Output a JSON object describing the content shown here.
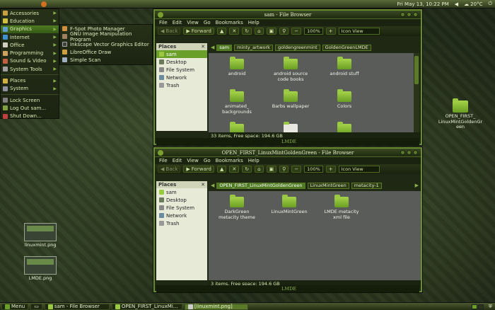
{
  "topbar": {
    "clock": "Fri May 13, 10:22 PM",
    "temp": "20°C"
  },
  "appmenu": {
    "items": [
      {
        "label": "Accessories",
        "color": "#c8a040"
      },
      {
        "label": "Education",
        "color": "#d0c040"
      },
      {
        "label": "Graphics",
        "color": "#60a0d0"
      },
      {
        "label": "Internet",
        "color": "#4090d0"
      },
      {
        "label": "Office",
        "color": "#d0d0c0"
      },
      {
        "label": "Programming",
        "color": "#d0a060"
      },
      {
        "label": "Sound & Video",
        "color": "#c06040"
      },
      {
        "label": "System Tools",
        "color": "#a0a0a0"
      },
      {
        "label": "Places",
        "color": "#d0b040"
      },
      {
        "label": "System",
        "color": "#9090a0"
      },
      {
        "label": "Lock Screen",
        "color": "#808080"
      },
      {
        "label": "Log Out sam...",
        "color": "#80a040"
      },
      {
        "label": "Shut Down...",
        "color": "#c04040"
      }
    ]
  },
  "submenu": {
    "items": [
      {
        "label": "F-Spot Photo Manager",
        "color": "#d09040"
      },
      {
        "label": "GNU Image Manipulation Program",
        "color": "#a08060"
      },
      {
        "label": "Inkscape Vector Graphics Editor",
        "color": "#404040"
      },
      {
        "label": "LibreOffice Draw",
        "color": "#d0a040"
      },
      {
        "label": "Simple Scan",
        "color": "#a0b0c0"
      }
    ]
  },
  "win1": {
    "title": "sam - File Browser",
    "menu": [
      "File",
      "Edit",
      "View",
      "Go",
      "Bookmarks",
      "Help"
    ],
    "back": "Back",
    "forward": "Forward",
    "zoom": "100%",
    "view": "Icon View",
    "places_header": "Places",
    "places": [
      "sam",
      "Desktop",
      "File System",
      "Network",
      "Trash"
    ],
    "crumbs": [
      "sam",
      "minty_artwork",
      "goldengreenmint",
      "GoldenGreenLMDE"
    ],
    "files": [
      "android",
      "android source code books",
      "android stuff",
      "animated_ backgrounds",
      "Barbs wallpaper",
      "Colors",
      "",
      "",
      ""
    ],
    "status": "33 items, Free space: 194.6 GB",
    "footer": "LMDE"
  },
  "win2": {
    "title": "OPEN_FIRST_LinuxMintGoldenGreen - File Browser",
    "menu": [
      "File",
      "Edit",
      "View",
      "Go",
      "Bookmarks",
      "Help"
    ],
    "back": "Back",
    "forward": "Forward",
    "zoom": "100%",
    "view": "Icon View",
    "places_header": "Places",
    "places": [
      "sam",
      "Desktop",
      "File System",
      "Network",
      "Trash"
    ],
    "crumbs": [
      "OPEN_FIRST_LinuxMintGoldenGreen",
      "LinuxMintGreen",
      "metacity-1"
    ],
    "files": [
      "DarkGreen metacity theme",
      "LinuxMintGreen",
      "LMDE metacity xml file"
    ],
    "status": "3 items, Free space: 194.6 GB",
    "footer": "LMDE"
  },
  "desktop": {
    "folder": "OPEN_FIRST_ LinuxMintGoldenGr een",
    "img1": "linuxmint.png",
    "img2": "LMDE.png"
  },
  "taskbar": {
    "menu": "Menu",
    "tasks": [
      "sam - File Browser",
      "OPEN_FIRST_LinuxMi...",
      "[linuxmint.png]"
    ]
  }
}
